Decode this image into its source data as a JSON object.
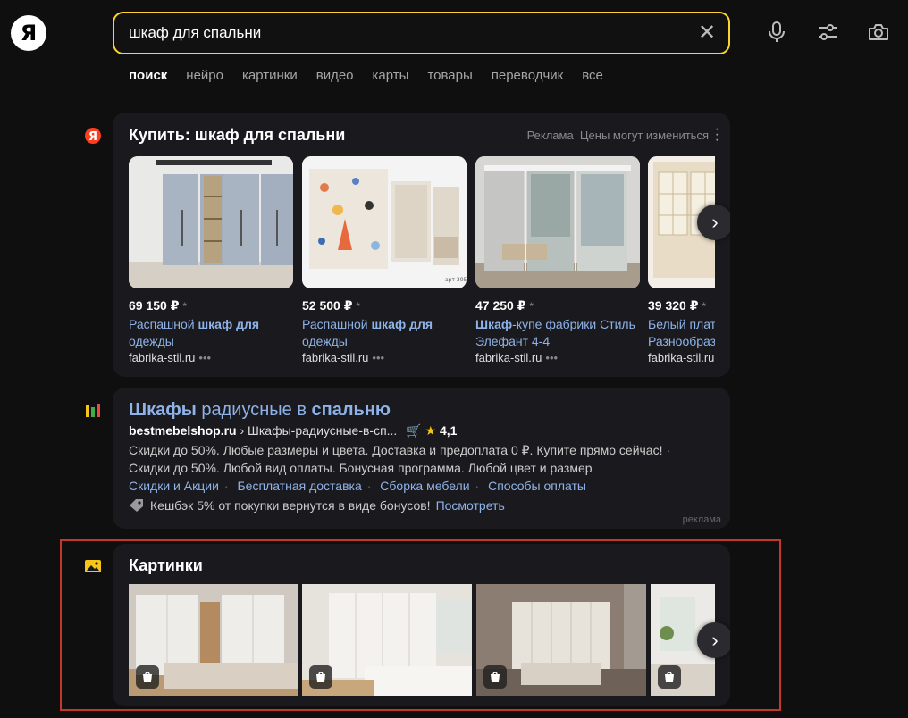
{
  "header": {
    "logo": "Я",
    "search_value": "шкаф для спальни"
  },
  "tabs": [
    "поиск",
    "нейро",
    "картинки",
    "видео",
    "карты",
    "товары",
    "переводчик",
    "все"
  ],
  "shopping": {
    "title": "Купить: шкаф для спальни",
    "meta": "Реклама  Цены могут измениться",
    "products": [
      {
        "price": "69 150 ₽",
        "star": "*",
        "title_pre": "Распашной ",
        "title_bold": "шкаф для",
        "title_post": " одежды",
        "shop": "fabrika-stil.ru"
      },
      {
        "price": "52 500 ₽",
        "star": "*",
        "title_pre": "Распашной ",
        "title_bold": "шкаф для",
        "title_post": " одежды",
        "shop": "fabrika-stil.ru"
      },
      {
        "price": "47 250 ₽",
        "star": "*",
        "title_pre": "",
        "title_bold": "Шкаф",
        "title_post": "-купе фабрики Стиль Элефант 4-4",
        "shop": "fabrika-stil.ru"
      },
      {
        "price": "39 320 ₽",
        "star": "*",
        "title_pre": "Белый плат Разнообраз",
        "title_bold": "",
        "title_post": "",
        "shop": "fabrika-stil.ru"
      }
    ]
  },
  "ad": {
    "title_bold1": "Шкафы",
    "title_mid": " радиусные в ",
    "title_bold2": "спальню",
    "url_domain": "bestmebelshop.ru",
    "url_path": " › Шкафы-радиусные-в-сп...",
    "rating": "4,1",
    "text": "Скидки до 50%. Любые размеры и цвета. Доставка и предоплата 0 ₽. Купите прямо сейчас! · Скидки до 50%. Любой вид оплаты. Бонусная программа. Любой цвет и размер",
    "links": [
      "Скидки и Акции",
      "Бесплатная доставка",
      "Сборка мебели",
      "Способы оплаты"
    ],
    "cashback": "Кешбэк 5% от покупки вернутся в виде бонусов!",
    "cashback_link": "Посмотреть",
    "label": "реклама"
  },
  "images_block": {
    "title": "Картинки"
  }
}
